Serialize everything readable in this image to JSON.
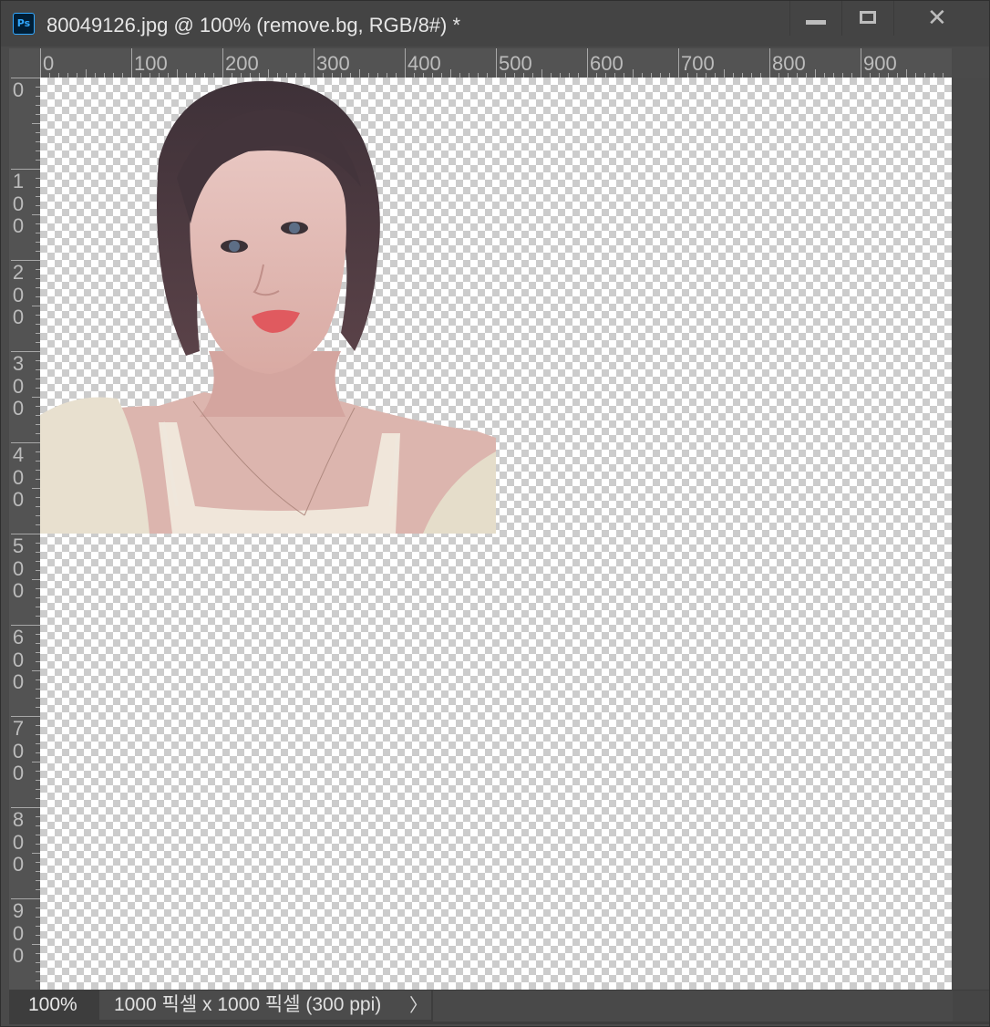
{
  "window": {
    "app_icon": "Ps",
    "title": "80049126.jpg @ 100% (remove.bg, RGB/8#) *",
    "controls": {
      "minimize_icon": "minimize-icon",
      "maximize_icon": "maximize-icon",
      "close_glyph": "✕"
    }
  },
  "rulers": {
    "top_labels": [
      "0",
      "100",
      "200",
      "300",
      "400",
      "500",
      "600",
      "700",
      "800",
      "900"
    ],
    "left_labels": [
      "0",
      "100",
      "200",
      "300",
      "400",
      "500",
      "600",
      "700",
      "800",
      "900"
    ]
  },
  "canvas": {
    "layer_name": "remove.bg",
    "image_subject": "cut-out portrait photo of a woman on transparent background"
  },
  "status_bar": {
    "zoom": "100%",
    "doc_info": "1000 픽셀 x 1000 픽셀 (300 ppi)",
    "arrow_glyph": "〉"
  },
  "colors": {
    "chrome_bg": "#4a4a4a",
    "ruler_bg": "#535353",
    "checker_light": "#ffffff",
    "checker_dark": "#cccccc",
    "ps_blue": "#31a8ff",
    "ps_navy": "#001e36"
  }
}
